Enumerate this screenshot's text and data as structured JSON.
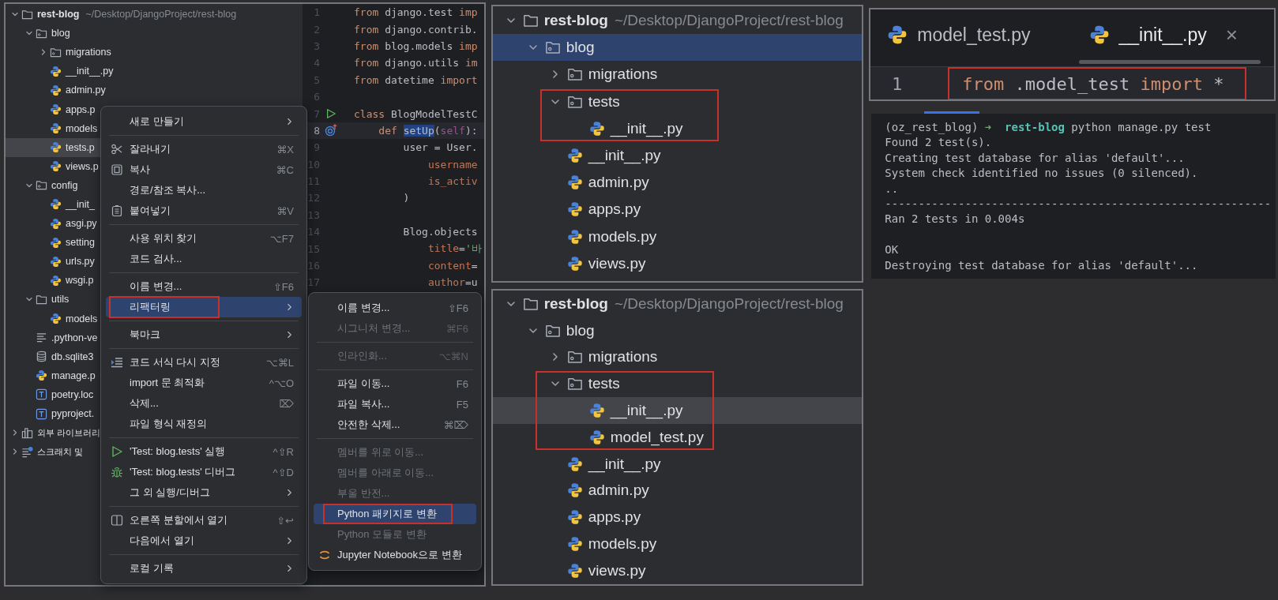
{
  "ide_panel": {
    "project_view": {
      "focused": false,
      "items": [
        {
          "name": "rest-blog",
          "path": "~/Desktop/DjangoProject/rest-blog",
          "kind": "folder",
          "expanded": true,
          "selected": false,
          "children": [
            {
              "name": "blog",
              "kind": "module",
              "expanded": true,
              "selected": false,
              "children": [
                {
                  "name": "migrations",
                  "kind": "module",
                  "expanded": false,
                  "selected": false
                },
                {
                  "name": "__init__.py",
                  "kind": "python",
                  "selected": false
                },
                {
                  "name": "admin.py",
                  "kind": "python",
                  "selected": false
                },
                {
                  "name": "apps.p",
                  "kind": "python",
                  "selected": false
                },
                {
                  "name": "models",
                  "kind": "python",
                  "selected": false
                },
                {
                  "name": "tests.p",
                  "kind": "python",
                  "selected": true
                },
                {
                  "name": "views.p",
                  "kind": "python",
                  "selected": false
                }
              ]
            },
            {
              "name": "config",
              "kind": "module",
              "expanded": true,
              "selected": false,
              "children": [
                {
                  "name": "__init_",
                  "kind": "python",
                  "selected": false
                },
                {
                  "name": "asgi.py",
                  "kind": "python",
                  "selected": false
                },
                {
                  "name": "setting",
                  "kind": "python",
                  "selected": false
                },
                {
                  "name": "urls.py",
                  "kind": "python",
                  "selected": false
                },
                {
                  "name": "wsgi.p",
                  "kind": "python",
                  "selected": false
                }
              ]
            },
            {
              "name": "utils",
              "kind": "folder",
              "expanded": true,
              "selected": false,
              "children": [
                {
                  "name": "models",
                  "kind": "python",
                  "selected": false
                }
              ]
            },
            {
              "name": ".python-ve",
              "kind": "text",
              "selected": false
            },
            {
              "name": "db.sqlite3",
              "kind": "database",
              "selected": false
            },
            {
              "name": "manage.p",
              "kind": "python",
              "selected": false
            },
            {
              "name": "poetry.loc",
              "kind": "toml",
              "selected": false
            },
            {
              "name": "pyproject.",
              "kind": "toml",
              "selected": false
            }
          ]
        },
        {
          "name": "외부 라이브러리",
          "kind": "library",
          "expanded": false,
          "selected": false
        },
        {
          "name": "스크래치 및",
          "kind": "scratch",
          "expanded": false,
          "selected": false
        }
      ]
    },
    "editor": {
      "lines": [
        {
          "number": "1",
          "kind": "code",
          "current": false,
          "tokens": [
            {
              "text": "from",
              "kind": "keyword"
            },
            {
              "text": " django.test ",
              "kind": "plain"
            },
            {
              "text": "imp",
              "kind": "keyword"
            }
          ]
        },
        {
          "number": "2",
          "kind": "code",
          "current": false,
          "tokens": [
            {
              "text": "from",
              "kind": "keyword"
            },
            {
              "text": " django.contrib.",
              "kind": "plain"
            }
          ]
        },
        {
          "number": "3",
          "kind": "code",
          "current": false,
          "tokens": [
            {
              "text": "from",
              "kind": "keyword"
            },
            {
              "text": " blog.models ",
              "kind": "plain"
            },
            {
              "text": "imp",
              "kind": "keyword"
            }
          ]
        },
        {
          "number": "4",
          "kind": "code",
          "current": false,
          "tokens": [
            {
              "text": "from",
              "kind": "keyword"
            },
            {
              "text": " django.utils ",
              "kind": "plain"
            },
            {
              "text": "im",
              "kind": "keyword"
            }
          ]
        },
        {
          "number": "5",
          "kind": "code",
          "current": false,
          "tokens": [
            {
              "text": "from",
              "kind": "keyword"
            },
            {
              "text": " datetime ",
              "kind": "plain"
            },
            {
              "text": "import",
              "kind": "keyword"
            }
          ]
        },
        {
          "number": "6",
          "kind": "code",
          "current": false
        },
        {
          "number": "7",
          "kind": "runnable",
          "current": false,
          "tokens": [
            {
              "text": "class",
              "kind": "keyword"
            },
            {
              "text": " BlogModelTestC",
              "kind": "plain"
            }
          ]
        },
        {
          "number": "8",
          "kind": "override",
          "current": true,
          "tokens": [
            {
              "text": "    def ",
              "kind": "keyword"
            },
            {
              "text": "setUp",
              "kind": "selection"
            },
            {
              "text": "(",
              "kind": "plain"
            },
            {
              "text": "self",
              "kind": "self"
            },
            {
              "text": "):",
              "kind": "plain"
            }
          ]
        },
        {
          "number": "9",
          "kind": "code",
          "current": false,
          "tokens": [
            {
              "text": "        user = User.",
              "kind": "plain"
            }
          ]
        },
        {
          "number": "10",
          "kind": "code",
          "current": false,
          "tokens": [
            {
              "text": "            username",
              "kind": "argument"
            }
          ]
        },
        {
          "number": "11",
          "kind": "code",
          "current": false,
          "tokens": [
            {
              "text": "            is_activ",
              "kind": "argument"
            }
          ]
        },
        {
          "number": "12",
          "kind": "code",
          "current": false,
          "tokens": [
            {
              "text": "        )",
              "kind": "plain"
            }
          ]
        },
        {
          "number": "13",
          "kind": "code",
          "current": false
        },
        {
          "number": "14",
          "kind": "code",
          "current": false,
          "tokens": [
            {
              "text": "        Blog.objects",
              "kind": "plain"
            }
          ]
        },
        {
          "number": "15",
          "kind": "code",
          "current": false,
          "tokens": [
            {
              "text": "            title",
              "kind": "argument"
            },
            {
              "text": "=",
              "kind": "plain"
            },
            {
              "text": "'바",
              "kind": "string"
            }
          ]
        },
        {
          "number": "16",
          "kind": "code",
          "current": false,
          "tokens": [
            {
              "text": "            content",
              "kind": "argument"
            },
            {
              "text": "=",
              "kind": "plain"
            }
          ]
        },
        {
          "number": "17",
          "kind": "code",
          "current": false,
          "tokens": [
            {
              "text": "            author",
              "kind": "argument"
            },
            {
              "text": "=u",
              "kind": "plain"
            }
          ]
        }
      ]
    },
    "context_menu": {
      "items": [
        {
          "kind": "plain",
          "label": "새로 만들기",
          "submenu": true,
          "selected": false,
          "disabled": false,
          "annotated": false
        },
        {
          "kind": "separator"
        },
        {
          "kind": "cut",
          "label": "잘라내기",
          "shortcut": "⌘X",
          "submenu": false,
          "selected": false,
          "disabled": false,
          "annotated": false
        },
        {
          "kind": "copy",
          "label": "복사",
          "shortcut": "⌘C",
          "submenu": false,
          "selected": false,
          "disabled": false,
          "annotated": false
        },
        {
          "kind": "plain",
          "label": "경로/참조 복사...",
          "submenu": false,
          "selected": false,
          "disabled": false,
          "annotated": false
        },
        {
          "kind": "paste",
          "label": "붙여넣기",
          "shortcut": "⌘V",
          "submenu": false,
          "selected": false,
          "disabled": false,
          "annotated": false
        },
        {
          "kind": "separator"
        },
        {
          "kind": "plain",
          "label": "사용 위치 찾기",
          "shortcut": "⌥F7",
          "submenu": false,
          "selected": false,
          "disabled": false,
          "annotated": false
        },
        {
          "kind": "plain",
          "label": "코드 검사...",
          "submenu": false,
          "selected": false,
          "disabled": false,
          "annotated": false
        },
        {
          "kind": "separator"
        },
        {
          "kind": "plain",
          "label": "이름 변경...",
          "shortcut": "⇧F6",
          "submenu": false,
          "selected": false,
          "disabled": false,
          "annotated": false
        },
        {
          "kind": "plain",
          "label": "리팩터링",
          "submenu": true,
          "selected": true,
          "disabled": false,
          "annotated": true
        },
        {
          "kind": "separator"
        },
        {
          "kind": "plain",
          "label": "북마크",
          "submenu": true,
          "selected": false,
          "disabled": false,
          "annotated": false
        },
        {
          "kind": "separator"
        },
        {
          "kind": "format",
          "label": "코드 서식 다시 지정",
          "shortcut": "⌥⌘L",
          "submenu": false,
          "selected": false,
          "disabled": false,
          "annotated": false
        },
        {
          "kind": "plain",
          "label": "import 문 최적화",
          "shortcut": "^⌥O",
          "submenu": false,
          "selected": false,
          "disabled": false,
          "annotated": false
        },
        {
          "kind": "plain",
          "label": "삭제...",
          "shortcut": "⌦",
          "submenu": false,
          "selected": false,
          "disabled": false,
          "annotated": false
        },
        {
          "kind": "plain",
          "label": "파일 형식 재정의",
          "submenu": false,
          "selected": false,
          "disabled": false,
          "annotated": false
        },
        {
          "kind": "separator"
        },
        {
          "kind": "run",
          "label": "'Test: blog.tests' 실행",
          "shortcut": "^⇧R",
          "submenu": false,
          "selected": false,
          "disabled": false,
          "annotated": false
        },
        {
          "kind": "debug",
          "label": "'Test: blog.tests' 디버그",
          "shortcut": "^⇧D",
          "submenu": false,
          "selected": false,
          "disabled": false,
          "annotated": false
        },
        {
          "kind": "plain",
          "label": "그 외 실행/디버그",
          "submenu": true,
          "selected": false,
          "disabled": false,
          "annotated": false
        },
        {
          "kind": "separator"
        },
        {
          "kind": "split",
          "label": "오른쪽 분할에서 열기",
          "shortcut": "⇧↩",
          "submenu": false,
          "selected": false,
          "disabled": false,
          "annotated": false
        },
        {
          "kind": "plain",
          "label": "다음에서 열기",
          "submenu": true,
          "selected": false,
          "disabled": false,
          "annotated": false
        },
        {
          "kind": "separator"
        },
        {
          "kind": "plain",
          "label": "로컬 기록",
          "submenu": true,
          "selected": false,
          "disabled": false,
          "annotated": false
        }
      ]
    },
    "refactor_submenu": {
      "items": [
        {
          "kind": "plain",
          "label": "이름 변경...",
          "shortcut": "⇧F6",
          "selected": false,
          "disabled": false,
          "annotated": false
        },
        {
          "kind": "plain",
          "label": "시그니처 변경...",
          "shortcut": "⌘F6",
          "selected": false,
          "disabled": true,
          "annotated": false
        },
        {
          "kind": "separator"
        },
        {
          "kind": "plain",
          "label": "인라인화...",
          "shortcut": "⌥⌘N",
          "selected": false,
          "disabled": true,
          "annotated": false
        },
        {
          "kind": "separator"
        },
        {
          "kind": "plain",
          "label": "파일 이동...",
          "shortcut": "F6",
          "selected": false,
          "disabled": false,
          "annotated": false
        },
        {
          "kind": "plain",
          "label": "파일 복사...",
          "shortcut": "F5",
          "selected": false,
          "disabled": false,
          "annotated": false
        },
        {
          "kind": "plain",
          "label": "안전한 삭제...",
          "shortcut": "⌘⌦",
          "selected": false,
          "disabled": false,
          "annotated": false
        },
        {
          "kind": "separator"
        },
        {
          "kind": "plain",
          "label": "멤버를 위로 이동...",
          "selected": false,
          "disabled": true,
          "annotated": false
        },
        {
          "kind": "plain",
          "label": "멤버를 아래로 이동...",
          "selected": false,
          "disabled": true,
          "annotated": false
        },
        {
          "kind": "plain",
          "label": "부울 반전...",
          "selected": false,
          "disabled": true,
          "annotated": false
        },
        {
          "kind": "plain",
          "label": "Python 패키지로 변환",
          "selected": true,
          "disabled": false,
          "annotated": true
        },
        {
          "kind": "plain",
          "label": "Python 모듈로 변환",
          "selected": false,
          "disabled": true,
          "annotated": false
        },
        {
          "kind": "jupyter",
          "label": "Jupyter Notebook으로 변환",
          "selected": false,
          "disabled": false,
          "annotated": false
        }
      ]
    }
  },
  "project_view_top": {
    "focused": true,
    "items": [
      {
        "name": "rest-blog",
        "path": "~/Desktop/DjangoProject/rest-blog",
        "kind": "folder",
        "expanded": true,
        "selected": false,
        "children": [
          {
            "name": "blog",
            "kind": "module",
            "expanded": true,
            "selected": true,
            "children": [
              {
                "name": "migrations",
                "kind": "module",
                "expanded": false,
                "selected": false
              },
              {
                "name": "tests",
                "kind": "module",
                "expanded": true,
                "selected": false,
                "annotated": true,
                "children": [
                  {
                    "name": "__init__.py",
                    "kind": "python",
                    "selected": false
                  }
                ]
              },
              {
                "name": "__init__.py",
                "kind": "python",
                "selected": false
              },
              {
                "name": "admin.py",
                "kind": "python",
                "selected": false
              },
              {
                "name": "apps.py",
                "kind": "python",
                "selected": false
              },
              {
                "name": "models.py",
                "kind": "python",
                "selected": false
              },
              {
                "name": "views.py",
                "kind": "python",
                "selected": false
              }
            ]
          }
        ]
      }
    ]
  },
  "project_view_bottom": {
    "focused": false,
    "items": [
      {
        "name": "rest-blog",
        "path": "~/Desktop/DjangoProject/rest-blog",
        "kind": "folder",
        "expanded": true,
        "selected": false,
        "children": [
          {
            "name": "blog",
            "kind": "module",
            "expanded": true,
            "selected": false,
            "children": [
              {
                "name": "migrations",
                "kind": "module",
                "expanded": false,
                "selected": false
              },
              {
                "name": "tests",
                "kind": "module",
                "expanded": true,
                "selected": false,
                "annotated": true,
                "children": [
                  {
                    "name": "__init__.py",
                    "kind": "python",
                    "selected": true
                  },
                  {
                    "name": "model_test.py",
                    "kind": "python",
                    "selected": false
                  }
                ]
              },
              {
                "name": "__init__.py",
                "kind": "python",
                "selected": false
              },
              {
                "name": "admin.py",
                "kind": "python",
                "selected": false
              },
              {
                "name": "apps.py",
                "kind": "python",
                "selected": false
              },
              {
                "name": "models.py",
                "kind": "python",
                "selected": false
              },
              {
                "name": "views.py",
                "kind": "python",
                "selected": false
              }
            ]
          }
        ]
      }
    ]
  },
  "init_editor": {
    "tabs": [
      {
        "label": "model_test.py",
        "selected": false
      },
      {
        "label": "__init__.py",
        "selected": true,
        "close": "×"
      }
    ],
    "lines": [
      {
        "number": "1",
        "current": true,
        "annotated": true,
        "tokens": [
          {
            "text": "from",
            "kind": "keyword"
          },
          {
            "text": " .model_test ",
            "kind": "plain"
          },
          {
            "text": "import",
            "kind": "keyword"
          },
          {
            "text": " *",
            "kind": "plain"
          }
        ]
      }
    ]
  },
  "terminal": {
    "lines": [
      {
        "segments": [
          {
            "text": "(oz_rest_blog) ",
            "kind": "plain"
          },
          {
            "text": "➜  ",
            "kind": "arrow"
          },
          {
            "text": "rest-blog",
            "kind": "directory"
          },
          {
            "text": " python manage.py test",
            "kind": "plain"
          }
        ]
      },
      {
        "segments": [
          {
            "text": "Found 2 test(s).",
            "kind": "plain"
          }
        ]
      },
      {
        "segments": [
          {
            "text": "Creating test database for alias 'default'...",
            "kind": "plain"
          }
        ]
      },
      {
        "segments": [
          {
            "text": "System check identified no issues (0 silenced).",
            "kind": "plain"
          }
        ]
      },
      {
        "segments": [
          {
            "text": "..",
            "kind": "plain"
          }
        ]
      },
      {
        "segments": [
          {
            "text": "----------------------------------------------------------",
            "kind": "plain"
          }
        ]
      },
      {
        "segments": [
          {
            "text": "Ran 2 tests in 0.004s",
            "kind": "plain"
          }
        ]
      },
      {
        "gap_before": true,
        "segments": [
          {
            "text": "OK",
            "kind": "plain"
          }
        ]
      },
      {
        "segments": [
          {
            "text": "Destroying test database for alias 'default'...",
            "kind": "plain"
          }
        ]
      }
    ]
  }
}
